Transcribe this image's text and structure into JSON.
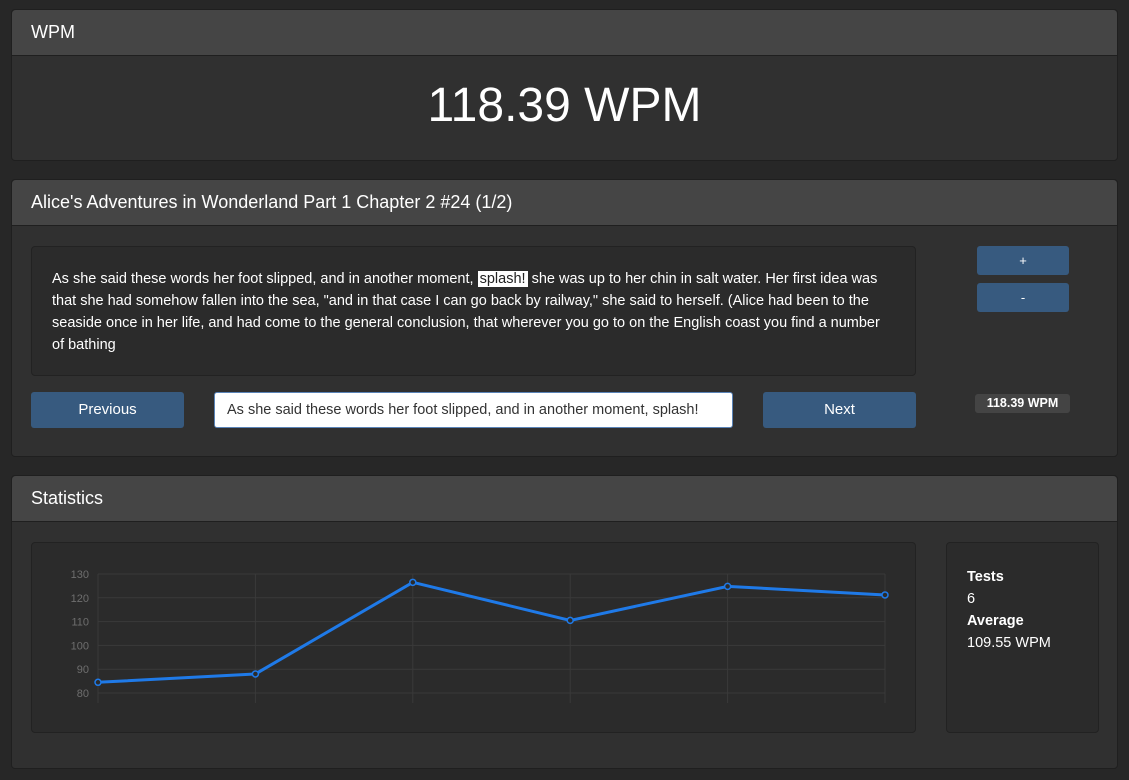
{
  "wpm_panel": {
    "title": "WPM",
    "value": "118.39 WPM"
  },
  "story": {
    "title": "Alice's Adventures in Wonderland Part 1 Chapter 2 #24 (1/2)",
    "text_before": "As she said these words her foot slipped, and in another moment,",
    "text_highlight": "splash!",
    "text_after": "she was up to her chin in salt water. Her first idea was that she had somehow fallen into the sea, \"and in that case I can go back by railway,\" she said to herself. (Alice had been to the seaside once in her life, and had come to the general conclusion, that wherever you go to on the English coast you find a number of bathing",
    "plus_label": "+",
    "minus_label": "-",
    "previous_label": "Previous",
    "next_label": "Next",
    "input_value": "As she said these words her foot slipped, and in another moment, splash!",
    "wpm_badge": "118.39 WPM"
  },
  "stats": {
    "title": "Statistics",
    "tests_label": "Tests",
    "tests_value": "6",
    "average_label": "Average",
    "average_value": "109.55 WPM"
  },
  "colors": {
    "accent": "#375a7f",
    "line": "#1f7ae8",
    "panel_head": "#454545"
  },
  "chart_data": {
    "type": "line",
    "x": [
      1,
      2,
      3,
      4,
      5,
      6
    ],
    "series": [
      {
        "values": [
          84.5,
          88,
          126.5,
          110.5,
          124.8,
          121.2
        ]
      }
    ],
    "ylim": [
      80,
      130
    ],
    "yticks": [
      80,
      90,
      100,
      110,
      120,
      130
    ],
    "grid": true,
    "title": "",
    "xlabel": "",
    "ylabel": ""
  }
}
